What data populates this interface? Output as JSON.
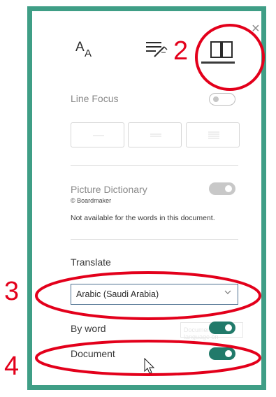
{
  "close_label": "×",
  "tabs": [
    {
      "name": "text-options",
      "icon": "font-size-icon",
      "glyph": "A"
    },
    {
      "name": "grammar-options",
      "icon": "grammar-wand-icon"
    },
    {
      "name": "reading-preferences",
      "icon": "book-icon",
      "active": true
    }
  ],
  "line_focus": {
    "label": "Line Focus",
    "enabled": false
  },
  "picture_dictionary": {
    "label": "Picture Dictionary",
    "credit": "© Boardmaker",
    "note": "Not available for the words in this document.",
    "enabled": true,
    "disabled": true
  },
  "translate": {
    "heading": "Translate",
    "language": "Arabic (Saudi Arabia)",
    "by_word_label": "By word",
    "by_word_on": true,
    "document_label": "Document",
    "document_on": true,
    "tooltip_ghost": "Document language en"
  },
  "annotations": {
    "num2": "2",
    "num3": "3",
    "num4": "4",
    "color": "#e3001b"
  },
  "colors": {
    "frame": "#3f9e86",
    "toggle_on": "#217a6a"
  }
}
